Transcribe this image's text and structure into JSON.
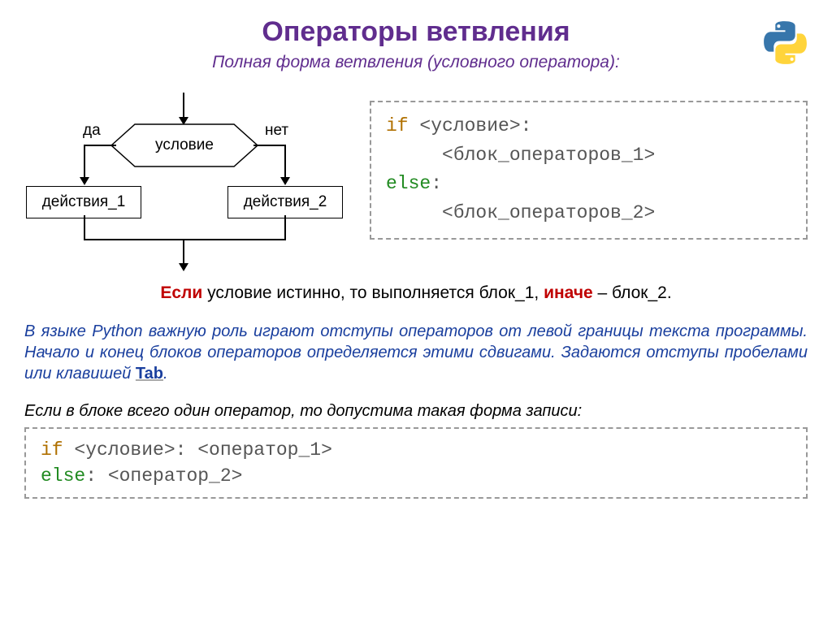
{
  "title": "Операторы ветвления",
  "subtitle": "Полная форма ветвления (условного оператора):",
  "flowchart": {
    "yes": "да",
    "no": "нет",
    "condition": "условие",
    "action1": "действия_1",
    "action2": "действия_2"
  },
  "code1": {
    "kw_if": "if",
    "cond": " <условие>:",
    "block1_indent": "     ",
    "block1": "<блок_операторов_1>",
    "kw_else": "else",
    "colon": ":",
    "block2_indent": "     ",
    "block2": "<блок_операторов_2>"
  },
  "explain": {
    "if_word": "Если",
    "mid": " условие истинно, то выполняется блок_1, ",
    "else_word": "иначе",
    "tail": " – блок_2."
  },
  "paragraph_pre": "В языке Python важную роль играют отступы операторов от левой границы текста программы. Начало и конец блоков операторов определяется этими сдвигами. Задаются отступы пробелами или клавишей ",
  "tab": "Tab",
  "paragraph_post": ".",
  "note": "Если в блоке всего один оператор, то допустима такая форма записи:",
  "code2": {
    "kw_if": "if",
    "cond": " <условие>: ",
    "op1": "<оператор_1>",
    "kw_else": "else",
    "colon": ": ",
    "op2": "<оператор_2>"
  }
}
